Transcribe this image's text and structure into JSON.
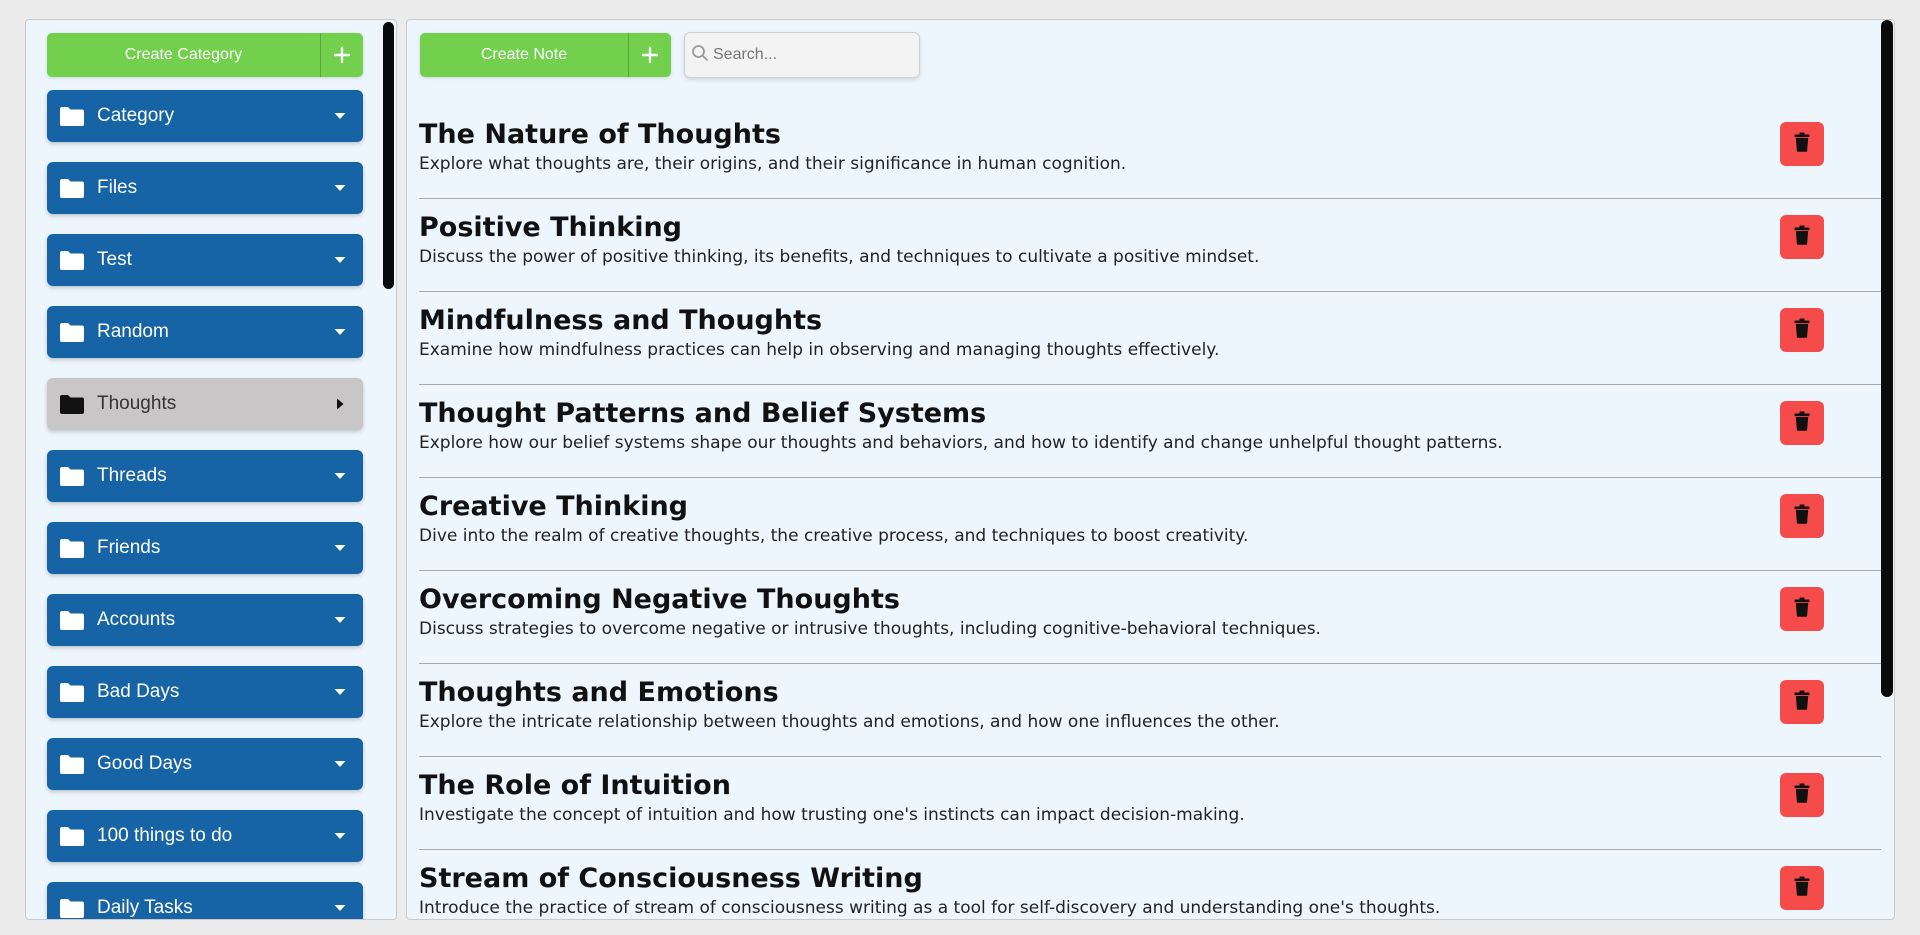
{
  "sidebar": {
    "create_label": "Create Category",
    "categories": [
      {
        "label": "Category",
        "expanded": true,
        "active": false
      },
      {
        "label": "Files",
        "expanded": true,
        "active": false
      },
      {
        "label": "Test",
        "expanded": true,
        "active": false
      },
      {
        "label": "Random",
        "expanded": true,
        "active": false
      },
      {
        "label": "Thoughts",
        "expanded": false,
        "active": true
      },
      {
        "label": "Threads",
        "expanded": true,
        "active": false
      },
      {
        "label": "Friends",
        "expanded": true,
        "active": false
      },
      {
        "label": "Accounts",
        "expanded": true,
        "active": false
      },
      {
        "label": "Bad Days",
        "expanded": true,
        "active": false
      },
      {
        "label": "Good Days",
        "expanded": true,
        "active": false
      },
      {
        "label": "100 things to do",
        "expanded": true,
        "active": false
      },
      {
        "label": "Daily Tasks",
        "expanded": true,
        "active": false
      }
    ]
  },
  "main": {
    "create_label": "Create Note",
    "search": {
      "placeholder": "Search...",
      "value": ""
    },
    "notes": [
      {
        "title": "The Nature of Thoughts",
        "description": "Explore what thoughts are, their origins, and their significance in human cognition."
      },
      {
        "title": "Positive Thinking",
        "description": "Discuss the power of positive thinking, its benefits, and techniques to cultivate a positive mindset."
      },
      {
        "title": "Mindfulness and Thoughts",
        "description": "Examine how mindfulness practices can help in observing and managing thoughts effectively."
      },
      {
        "title": "Thought Patterns and Belief Systems",
        "description": "Explore how our belief systems shape our thoughts and behaviors, and how to identify and change unhelpful thought patterns."
      },
      {
        "title": "Creative Thinking",
        "description": "Dive into the realm of creative thoughts, the creative process, and techniques to boost creativity."
      },
      {
        "title": "Overcoming Negative Thoughts",
        "description": "Discuss strategies to overcome negative or intrusive thoughts, including cognitive-behavioral techniques."
      },
      {
        "title": "Thoughts and Emotions",
        "description": "Explore the intricate relationship between thoughts and emotions, and how one influences the other."
      },
      {
        "title": "The Role of Intuition",
        "description": "Investigate the concept of intuition and how trusting one's instincts can impact decision-making."
      },
      {
        "title": "Stream of Consciousness Writing",
        "description": "Introduce the practice of stream of consciousness writing as a tool for self-discovery and understanding one's thoughts."
      }
    ]
  },
  "icons": {
    "folder": "folder-icon",
    "caret_down": "caret-down-icon",
    "caret_right": "caret-right-icon",
    "plus": "plus-icon",
    "search": "search-icon",
    "trash": "trash-icon"
  },
  "colors": {
    "create_green": "#72d04d",
    "category_blue": "#1663a5",
    "active_gray": "#c8c6c6",
    "delete_red": "#f54b4b",
    "panel_bg": "#eef6fd"
  }
}
